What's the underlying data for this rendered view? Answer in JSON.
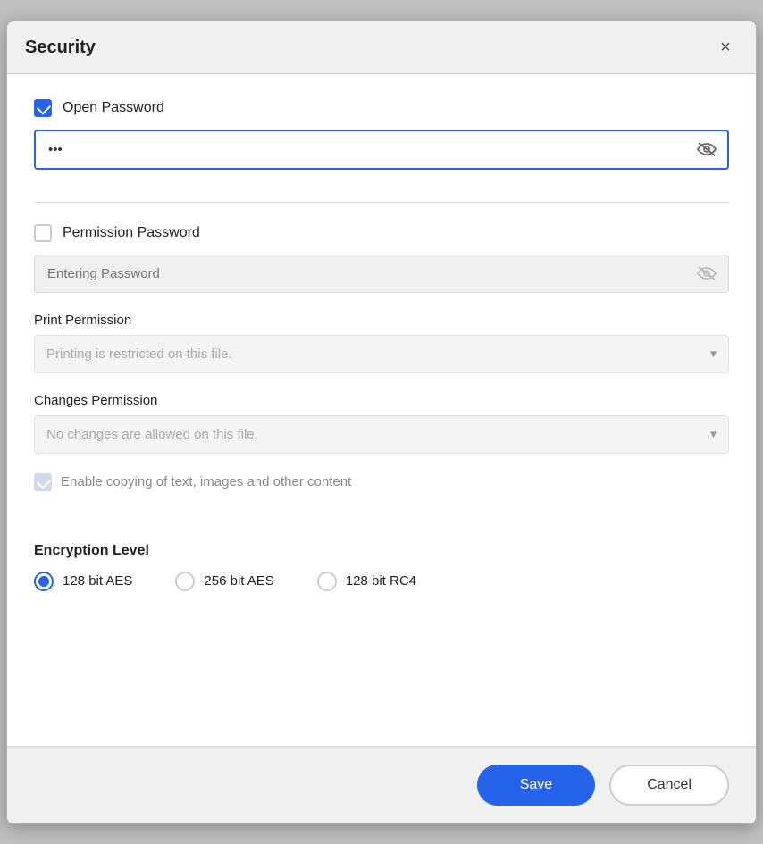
{
  "dialog": {
    "title": "Security",
    "close_label": "×"
  },
  "open_password": {
    "label": "Open Password",
    "checked": true,
    "value": "•••",
    "placeholder": "",
    "toggle_aria": "Toggle password visibility"
  },
  "permission_password": {
    "label": "Permission Password",
    "checked": false,
    "placeholder": "Entering Password",
    "toggle_aria": "Toggle password visibility"
  },
  "print_permission": {
    "label": "Print Permission",
    "placeholder": "Printing is restricted on this file."
  },
  "changes_permission": {
    "label": "Changes Permission",
    "placeholder": "No changes are allowed on this file."
  },
  "enable_copy": {
    "label": "Enable copying of text, images and other content",
    "checked": true,
    "disabled": true
  },
  "encryption_level": {
    "title": "Encryption Level",
    "options": [
      {
        "value": "128aes",
        "label": "128 bit AES",
        "selected": true
      },
      {
        "value": "256aes",
        "label": "256 bit AES",
        "selected": false
      },
      {
        "value": "128rc4",
        "label": "128 bit RC4",
        "selected": false
      }
    ]
  },
  "footer": {
    "save_label": "Save",
    "cancel_label": "Cancel"
  }
}
